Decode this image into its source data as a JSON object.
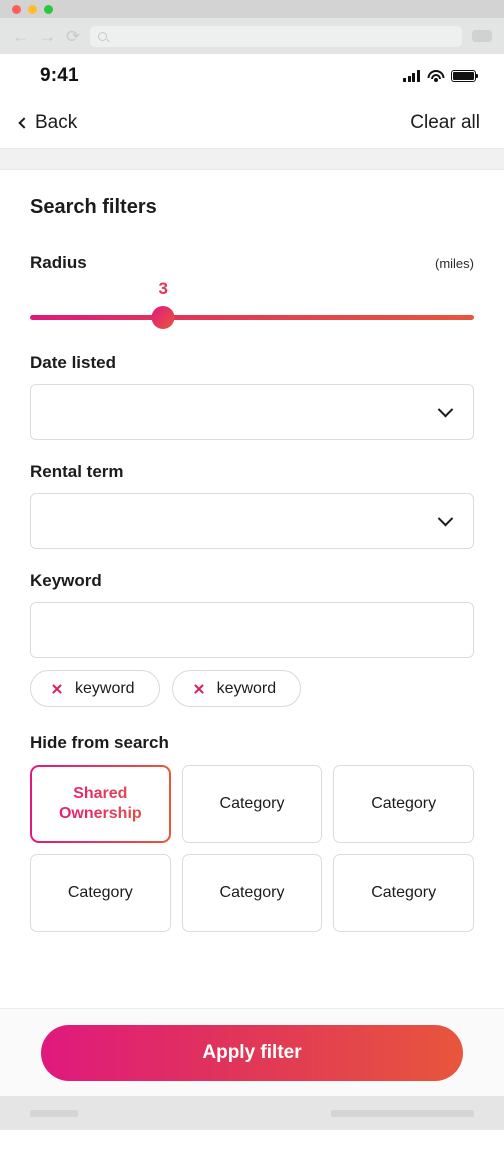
{
  "browser": {
    "traffic_lights": [
      {
        "name": "close",
        "color": "#ff5f57"
      },
      {
        "name": "minimize",
        "color": "#febc2e"
      },
      {
        "name": "maximize",
        "color": "#28c840"
      }
    ],
    "back_glyph": "←",
    "forward_glyph": "→",
    "reload_glyph": "⟳",
    "url_value": ""
  },
  "status_bar": {
    "time": "9:41",
    "signal_icon": "cellular-signal-icon",
    "wifi_icon": "wifi-icon",
    "battery_icon": "battery-icon"
  },
  "nav_bar": {
    "back_label": "Back",
    "back_icon": "chevron-left-icon",
    "clear_all_label": "Clear all"
  },
  "main": {
    "title": "Search filters",
    "radius": {
      "label": "Radius",
      "unit": "(miles)",
      "value": "3",
      "min": 0,
      "max": 10,
      "percent": 30
    },
    "date_listed": {
      "label": "Date listed",
      "value": "",
      "placeholder": "",
      "chevron_icon": "chevron-down-icon"
    },
    "rental_term": {
      "label": "Rental term",
      "value": "",
      "placeholder": "",
      "chevron_icon": "chevron-down-icon"
    },
    "keyword": {
      "label": "Keyword",
      "value": "",
      "placeholder": "",
      "chips": [
        {
          "label": "keyword",
          "remove_icon": "close-icon"
        },
        {
          "label": "keyword",
          "remove_icon": "close-icon"
        }
      ]
    },
    "hide_from_search": {
      "label": "Hide from search",
      "categories": [
        {
          "label": "Shared Ownership",
          "selected": true
        },
        {
          "label": "Category",
          "selected": false
        },
        {
          "label": "Category",
          "selected": false
        },
        {
          "label": "Category",
          "selected": false
        },
        {
          "label": "Category",
          "selected": false
        },
        {
          "label": "Category",
          "selected": false
        }
      ]
    }
  },
  "footer": {
    "apply_label": "Apply filter"
  },
  "colors": {
    "gradient_start": "#e0197e",
    "gradient_mid": "#e0345a",
    "gradient_end": "#e8563c",
    "accent_pink": "#d81e5b",
    "text_primary": "#1c1c1c",
    "border": "#dcdcdc"
  }
}
